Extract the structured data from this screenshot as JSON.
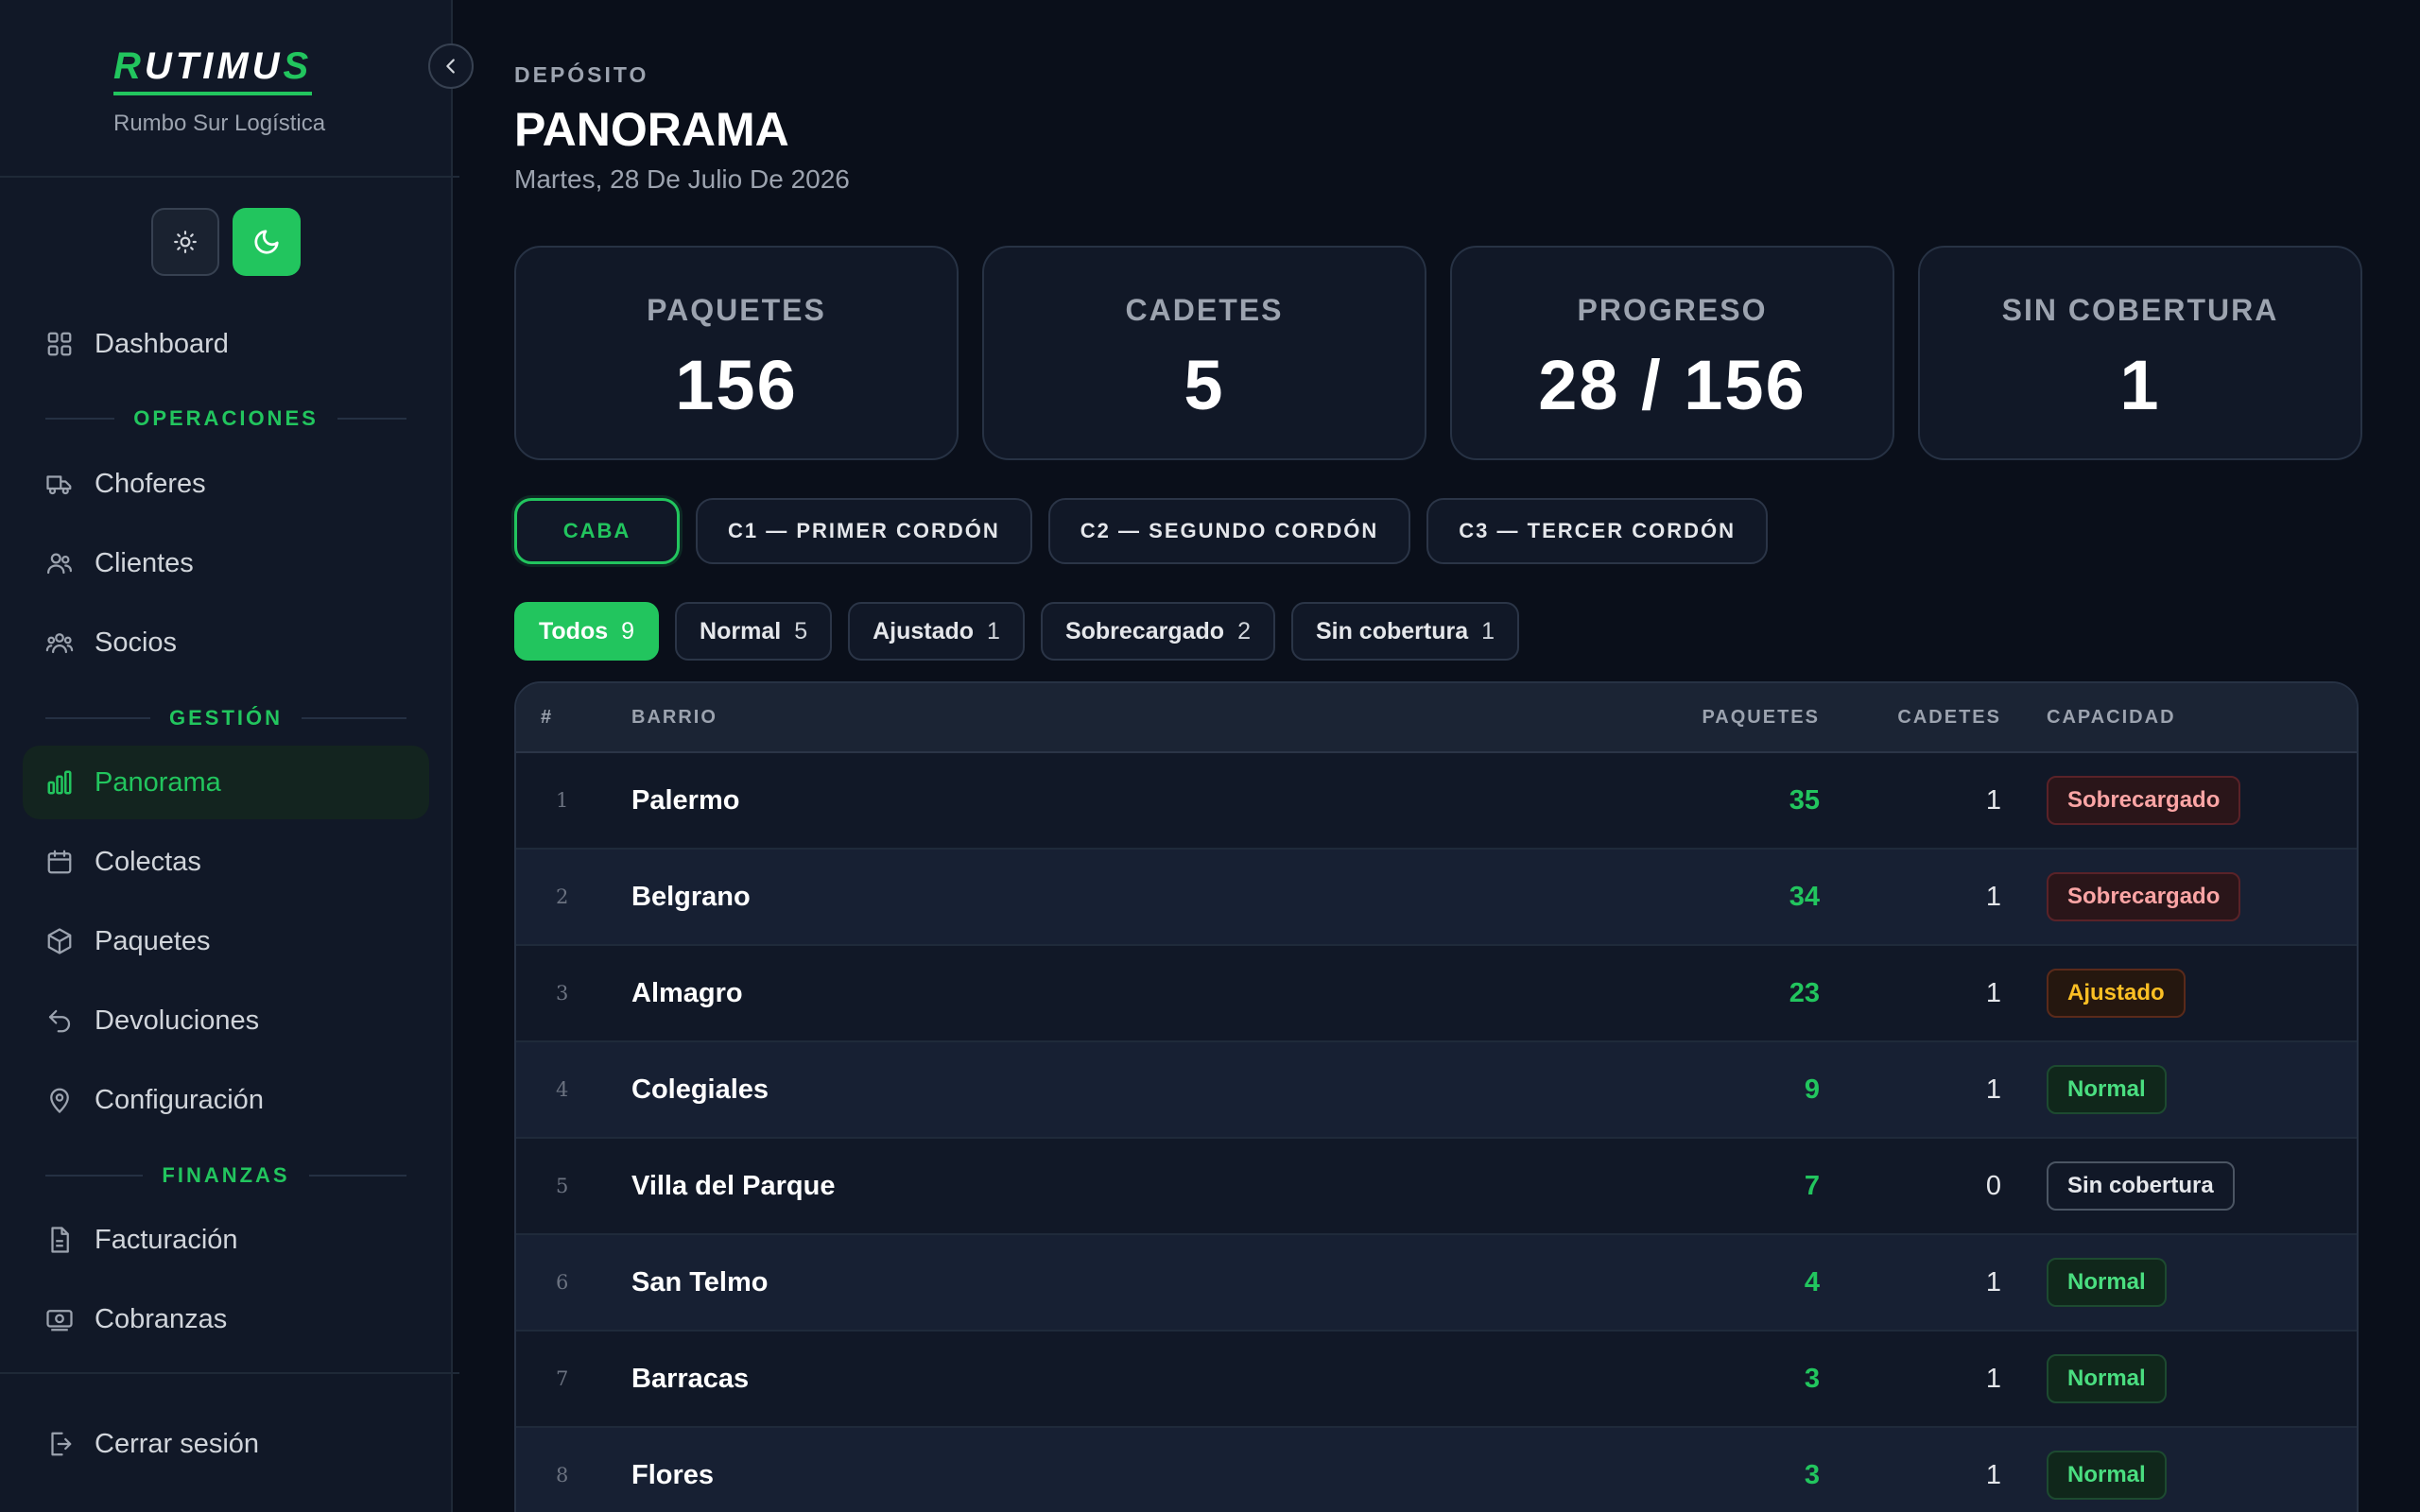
{
  "brand": {
    "logo_r": "R",
    "logo_mid": "UTIMU",
    "logo_s": "S",
    "subtitle": "Rumbo Sur Logística"
  },
  "sidebar": {
    "dashboard": "Dashboard",
    "section_operaciones": "OPERACIONES",
    "choferes": "Choferes",
    "clientes": "Clientes",
    "socios": "Socios",
    "section_gestion": "GESTIÓN",
    "panorama": "Panorama",
    "colectas": "Colectas",
    "paquetes": "Paquetes",
    "devoluciones": "Devoluciones",
    "configuracion": "Configuración",
    "section_finanzas": "FINANZAS",
    "facturacion": "Facturación",
    "cobranzas": "Cobranzas",
    "logout": "Cerrar sesión"
  },
  "header": {
    "eyebrow": "DEPÓSITO",
    "title": "PANORAMA",
    "date": "Martes, 28 De Julio De 2026"
  },
  "stats": [
    {
      "label": "PAQUETES",
      "value": "156"
    },
    {
      "label": "CADETES",
      "value": "5"
    },
    {
      "label": "PROGRESO",
      "value": "28 / 156"
    },
    {
      "label": "SIN COBERTURA",
      "value": "1"
    }
  ],
  "zones": [
    "CABA",
    "C1 — PRIMER CORDÓN",
    "C2 — SEGUNDO CORDÓN",
    "C3 — TERCER CORDÓN"
  ],
  "filters": [
    {
      "label": "Todos",
      "count": "9"
    },
    {
      "label": "Normal",
      "count": "5"
    },
    {
      "label": "Ajustado",
      "count": "1"
    },
    {
      "label": "Sobrecargado",
      "count": "2"
    },
    {
      "label": "Sin cobertura",
      "count": "1"
    }
  ],
  "table": {
    "headers": {
      "idx": "#",
      "barrio": "BARRIO",
      "paquetes": "PAQUETES",
      "cadetes": "CADETES",
      "capacidad": "CAPACIDAD"
    },
    "rows": [
      {
        "idx": "1",
        "barrio": "Palermo",
        "paquetes": "35",
        "cadetes": "1",
        "capacidad": "Sobrecargado"
      },
      {
        "idx": "2",
        "barrio": "Belgrano",
        "paquetes": "34",
        "cadetes": "1",
        "capacidad": "Sobrecargado"
      },
      {
        "idx": "3",
        "barrio": "Almagro",
        "paquetes": "23",
        "cadetes": "1",
        "capacidad": "Ajustado"
      },
      {
        "idx": "4",
        "barrio": "Colegiales",
        "paquetes": "9",
        "cadetes": "1",
        "capacidad": "Normal"
      },
      {
        "idx": "5",
        "barrio": "Villa del Parque",
        "paquetes": "7",
        "cadetes": "0",
        "capacidad": "Sin cobertura"
      },
      {
        "idx": "6",
        "barrio": "San Telmo",
        "paquetes": "4",
        "cadetes": "1",
        "capacidad": "Normal"
      },
      {
        "idx": "7",
        "barrio": "Barracas",
        "paquetes": "3",
        "cadetes": "1",
        "capacidad": "Normal"
      },
      {
        "idx": "8",
        "barrio": "Flores",
        "paquetes": "3",
        "cadetes": "1",
        "capacidad": "Normal"
      }
    ]
  },
  "colors": {
    "accent": "#22c55e",
    "background": "#0a0f1a",
    "sidebar": "#111827"
  }
}
